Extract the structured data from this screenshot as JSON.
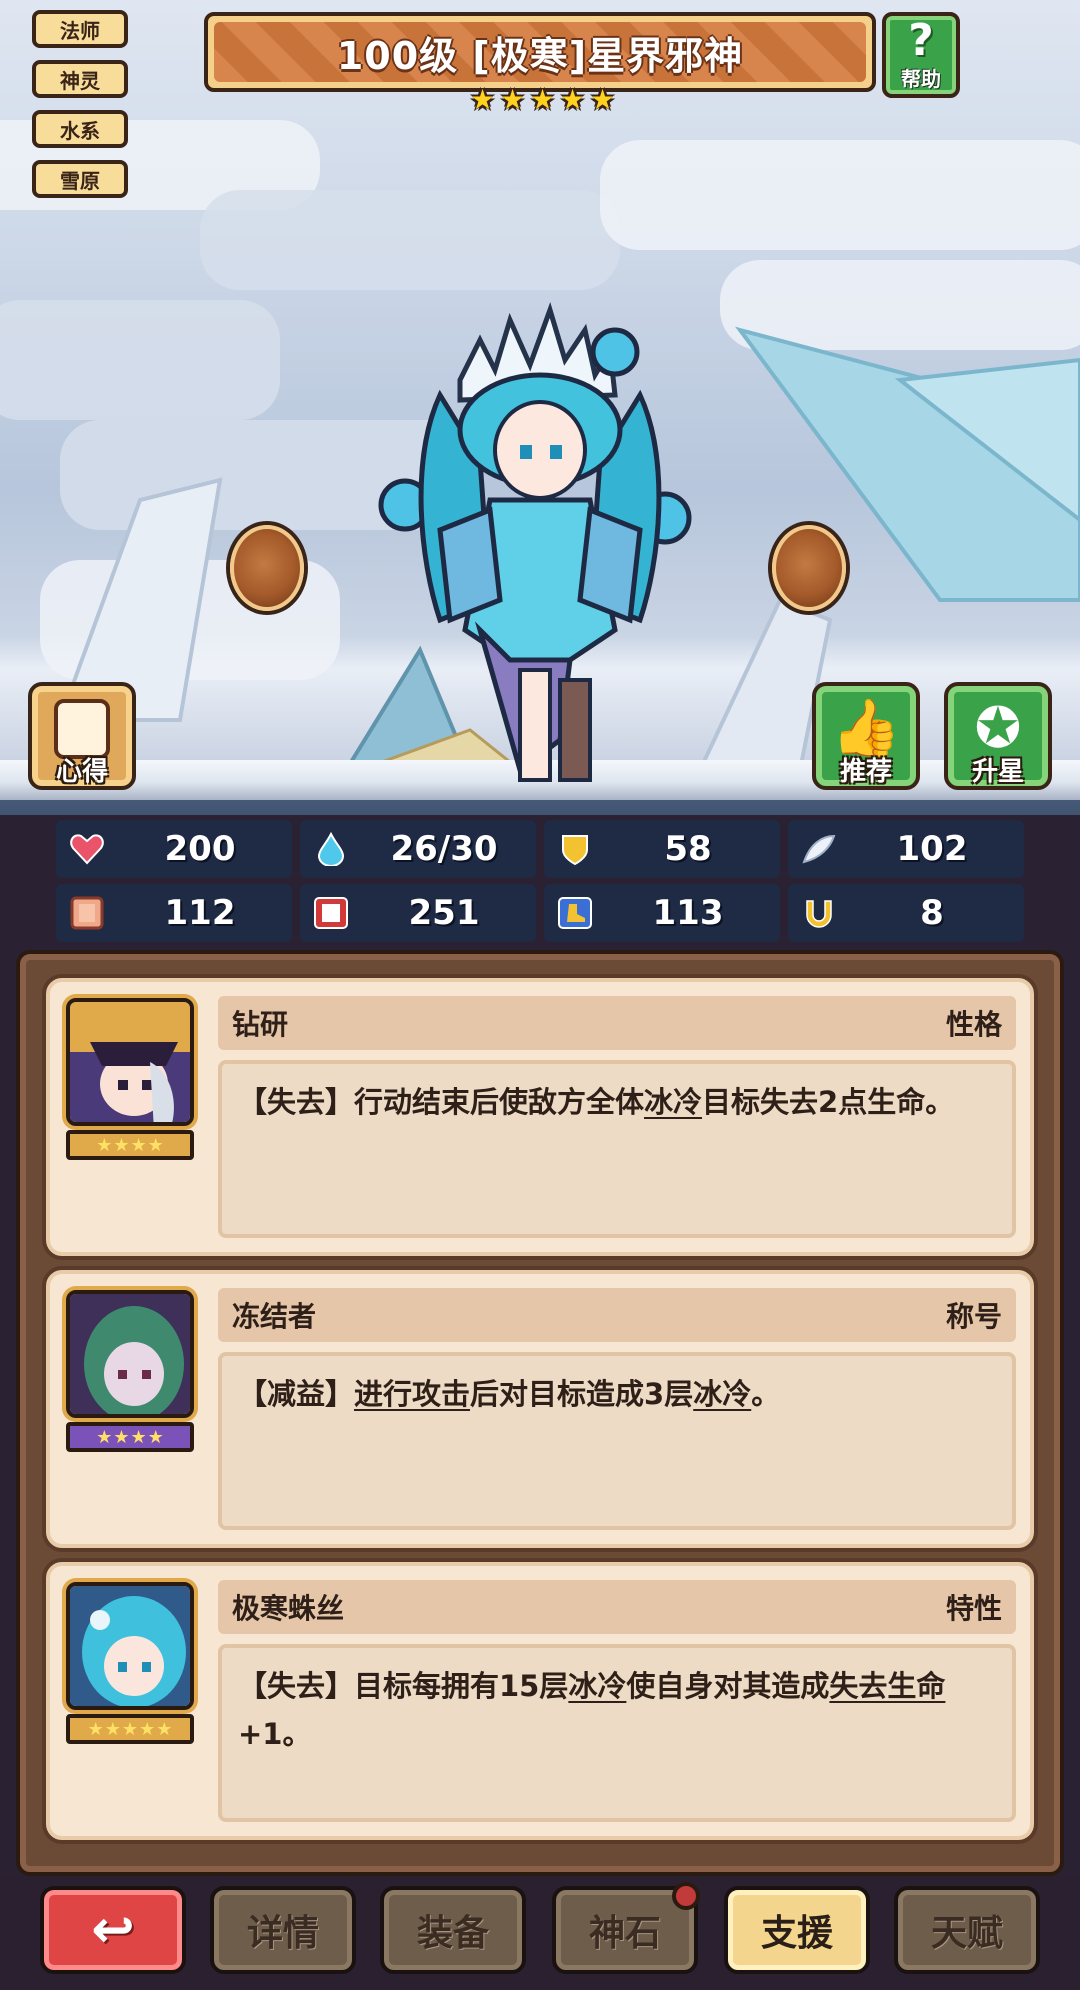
{
  "title": "100级 [极寒]星界邪神",
  "star_count": 5,
  "tags": [
    "法师",
    "神灵",
    "水系",
    "雪原"
  ],
  "help_label": "帮助",
  "side_buttons": {
    "xinde": "心得",
    "tuijian": "推荐",
    "shengxing": "升星"
  },
  "stats": [
    {
      "icon": "heart-icon",
      "value": "200"
    },
    {
      "icon": "mana-drop-icon",
      "value": "26/30"
    },
    {
      "icon": "shield-icon",
      "value": "58"
    },
    {
      "icon": "feather-icon",
      "value": "102"
    },
    {
      "icon": "fist-icon",
      "value": "112"
    },
    {
      "icon": "spellbook-icon",
      "value": "251"
    },
    {
      "icon": "boot-icon",
      "value": "113"
    },
    {
      "icon": "horseshoe-icon",
      "value": "8"
    }
  ],
  "cards": [
    {
      "name": "钻研",
      "category": "性格",
      "stars": 4,
      "segments": [
        "【失去】行动结束后使敌方全体",
        "冰冷",
        "目标失去2点生命。"
      ]
    },
    {
      "name": "冻结者",
      "category": "称号",
      "stars": 4,
      "segments": [
        "【减益】",
        "进行攻击",
        "后对目标造成3层",
        "冰冷",
        "。"
      ]
    },
    {
      "name": "极寒蛛丝",
      "category": "特性",
      "stars": 5,
      "segments": [
        "【失去】目标每拥有15层",
        "冰冷",
        "使自身对其造成",
        "失去生命",
        "+1。"
      ]
    }
  ],
  "nav": {
    "details": "详情",
    "equipment": "装备",
    "godstone": "神石",
    "support": "支援",
    "talent": "天赋"
  }
}
